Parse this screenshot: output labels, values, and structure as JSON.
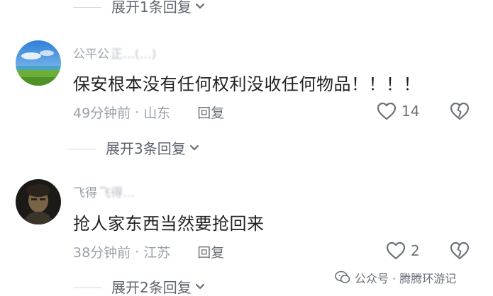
{
  "replies_top": {
    "label": "展开1条回复"
  },
  "comments": [
    {
      "username": "公平公",
      "username_blurred": "正…(…)",
      "text": "保安根本没有任何权利没收任何物品！！！！",
      "time": "49分钟前",
      "separator": "·",
      "location": "山东",
      "reply_label": "回复",
      "likes": "14",
      "expand_label": "展开3条回复"
    },
    {
      "username": "飞得",
      "username_blurred": "飞得…",
      "text": "抢人家东西当然要抢回来",
      "time": "38分钟前",
      "separator": "·",
      "location": "江苏",
      "reply_label": "回复",
      "likes": "2",
      "expand_label": "展开2条回复"
    }
  ],
  "watermark": {
    "text": "公众号 · 腾腾环游记"
  },
  "colors": {
    "text": "#222222",
    "muted": "#9aa0aa",
    "icon": "#6b7079"
  },
  "icons": [
    "chevron-down-icon",
    "heart-icon",
    "broken-heart-icon",
    "wechat-icon"
  ]
}
